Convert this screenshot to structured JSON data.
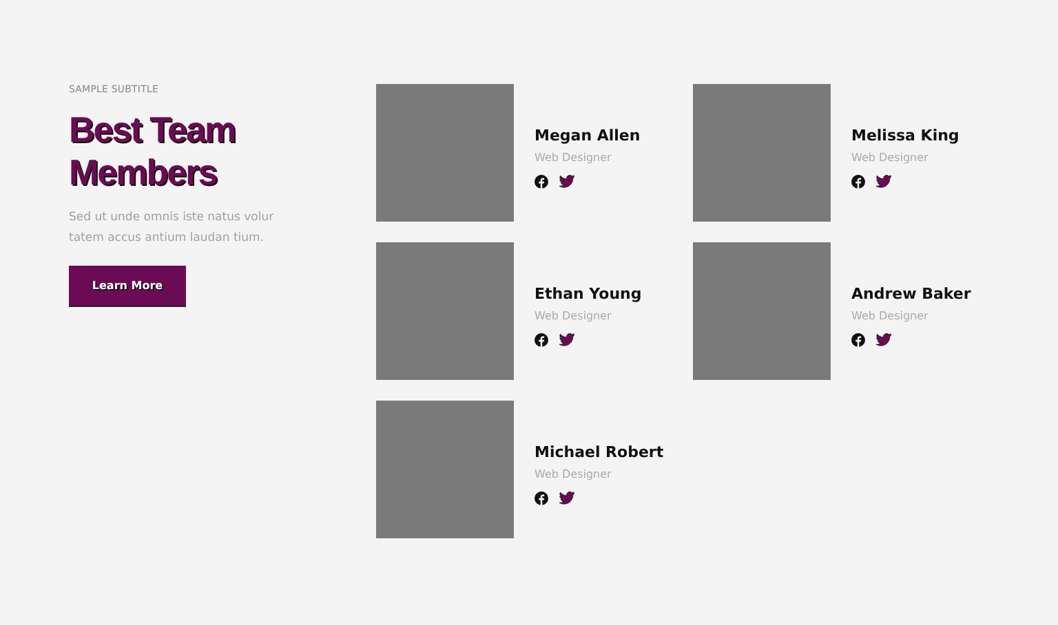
{
  "intro": {
    "subtitle": "SAMPLE SUBTITLE",
    "title": "Best Team Members",
    "text": "Sed ut unde omnis iste natus volur tatem accus antium laudan tium.",
    "button": "Learn More"
  },
  "members": [
    {
      "name": "Megan Allen",
      "role": "Web Designer"
    },
    {
      "name": "Melissa King",
      "role": "Web Designer"
    },
    {
      "name": "Ethan Young",
      "role": "Web Designer"
    },
    {
      "name": "Andrew Baker",
      "role": "Web Designer"
    },
    {
      "name": "Michael Robert",
      "role": "Web Designer"
    }
  ]
}
